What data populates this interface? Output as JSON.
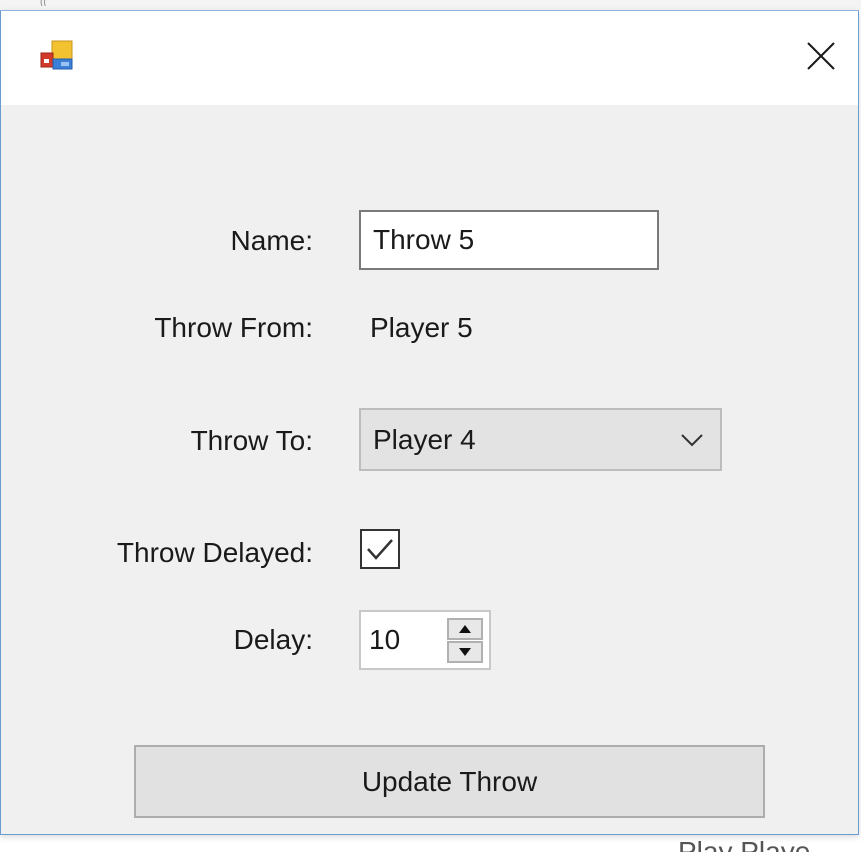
{
  "background": {
    "top_text": "((",
    "bottom_text": "Play   Playe"
  },
  "window": {
    "title": "",
    "app_icon": "winforms-app-icon",
    "close_icon": "close-icon"
  },
  "form": {
    "name_label": "Name:",
    "name_value": "Throw 5",
    "throw_from_label": "Throw From:",
    "throw_from_value": "Player 5",
    "throw_to_label": "Throw To:",
    "throw_to_selected": "Player 4",
    "throw_delayed_label": "Throw Delayed:",
    "throw_delayed_checked": true,
    "delay_label": "Delay:",
    "delay_value": "10",
    "update_button": "Update Throw"
  },
  "colors": {
    "dialog_bg": "#f0f0f0",
    "titlebar_bg": "#ffffff",
    "border_accent": "#6a9bd1"
  }
}
